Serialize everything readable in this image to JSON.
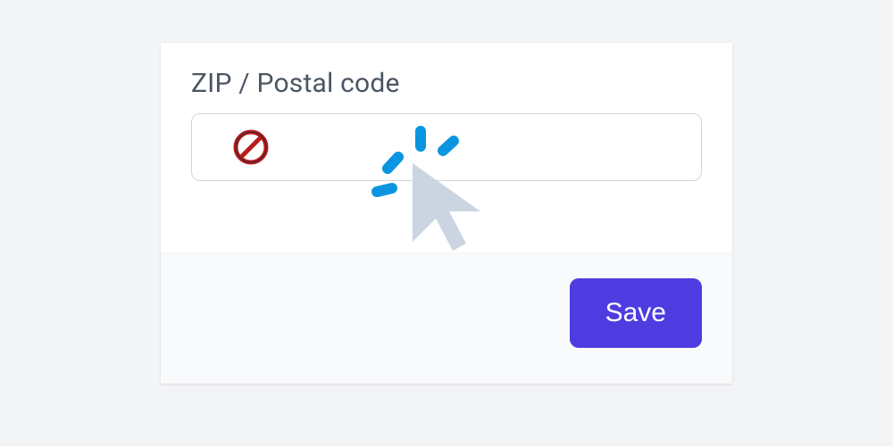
{
  "field": {
    "label": "ZIP / Postal code",
    "value": "",
    "placeholder": ""
  },
  "actions": {
    "save_label": "Save"
  },
  "icons": {
    "no_entry": "no-entry-icon",
    "cursor_click": "cursor-click-icon"
  },
  "colors": {
    "primary": "#4f3ce0",
    "text": "#4b5563",
    "border": "#d1d5db",
    "accent_blue": "#0ea5e9",
    "cursor_gray": "#cbd5e1",
    "error_red": "#b91c1c"
  }
}
